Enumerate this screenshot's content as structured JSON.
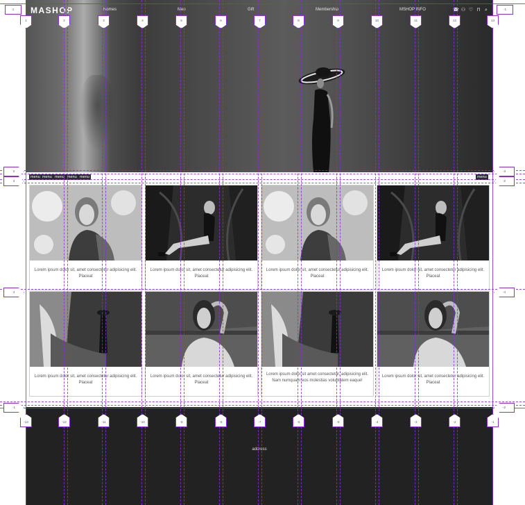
{
  "header": {
    "logo": "MASHOP",
    "nav": [
      "Homes",
      "Men",
      "Gift",
      "Membership",
      "MSHOP INFO"
    ],
    "icons": [
      "phone-icon",
      "user-icon",
      "heart-icon",
      "bag-icon",
      "search-icon"
    ]
  },
  "categories": {
    "left": [
      "menu",
      "menu",
      "menu",
      "menu",
      "menu"
    ],
    "right": "menu"
  },
  "products": [
    {
      "caption": "Lorem ipsum dolor sit, amet consectetur adipisicing elit. Placeat"
    },
    {
      "caption": "Lorem ipsum dolor sit, amet consectetur adipisicing elit. Placeat"
    },
    {
      "caption": "Lorem ipsum dolor sit, amet consectetur adipisicing elit. Placeat"
    },
    {
      "caption": "Lorem ipsum dolor sit, amet consectetur adipisicing elit. Placeat"
    },
    {
      "caption": "Lorem ipsum dolor sit, amet consectetur adipisicing elit. Placeat"
    },
    {
      "caption": "Lorem ipsum dolor sit, amet consectetur adipisicing elit. Placeat"
    },
    {
      "caption": "Lorem ipsum dolor sit amet consectetur, adipisicing elit. Nam numquam eos molestias voluptatem eaque!"
    },
    {
      "caption": "Lorem ipsum dolor sit, amet consectetur adipisicing elit. Placeat"
    }
  ],
  "footer": {
    "address": "address"
  },
  "guides": {
    "top_markers": [
      "1",
      "2",
      "3",
      "4",
      "5",
      "6",
      "7",
      "8",
      "9",
      "10",
      "11",
      "12",
      "13"
    ],
    "bottom_markers": [
      "-13",
      "-12",
      "-11",
      "-10",
      "-9",
      "-8",
      "-7",
      "-6",
      "-5",
      "-4",
      "-3",
      "-2",
      "-1"
    ],
    "corner_left": "1",
    "corner_right": "-1",
    "side_left": [
      "2",
      "3",
      "4"
    ],
    "side_right": [
      "-3",
      "-2",
      "-4"
    ],
    "bottom_left": "-1",
    "bottom_right": "-2",
    "color": "#8a2be2"
  }
}
